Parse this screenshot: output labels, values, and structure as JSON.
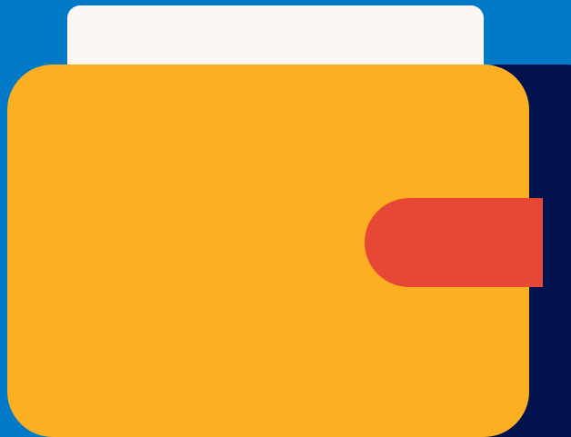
{
  "illustration": {
    "icon": "wallet-icon",
    "colors": {
      "background": "#0079C6",
      "card": "#FDF7F4",
      "wallet_back": "#02124F",
      "wallet_front": "#FDAF22",
      "clasp": "#E74735"
    }
  }
}
